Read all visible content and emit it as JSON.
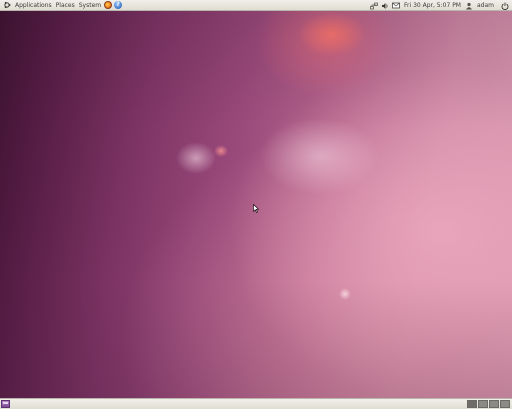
{
  "top_panel": {
    "menus": [
      "Applications",
      "Places",
      "System"
    ],
    "launchers": [
      {
        "name": "firefox-icon"
      },
      {
        "name": "help-icon",
        "glyph": "?"
      }
    ],
    "tray": {
      "clock": "Fri 30 Apr,  5:07 PM",
      "user": "adam"
    }
  },
  "bottom_panel": {
    "workspaces": 4,
    "active_workspace": 1
  },
  "colors": {
    "panel": "#e8e6df",
    "wallpaper_dark": "#3c1230",
    "wallpaper_light": "#d99ab0"
  }
}
